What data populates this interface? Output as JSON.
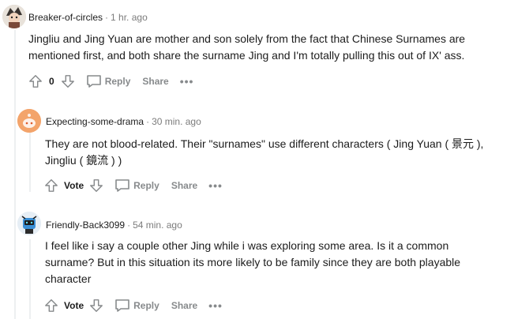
{
  "comments": [
    {
      "author": "Breaker-of-circles",
      "time": "1 hr. ago",
      "body": "Jingliu and Jing Yuan are mother and son solely from the fact that Chinese Surnames are mentioned first, and both share the surname Jing and I'm totally pulling this out of IX' ass.",
      "score": "0",
      "reply_label": "Reply",
      "share_label": "Share",
      "more_label": "•••",
      "avatar_color": "#8a7d72"
    },
    {
      "author": "Expecting-some-drama",
      "time": "30 min. ago",
      "body": "They are not blood-related. Their \"surnames\" use different characters ( Jing Yuan ( 景元 ), Jingliu ( 鏡流 ) )",
      "vote_label": "Vote",
      "reply_label": "Reply",
      "share_label": "Share",
      "more_label": "•••",
      "avatar_color": "#f3a46b"
    },
    {
      "author": "Friendly-Back3099",
      "time": "54 min. ago",
      "body": "I feel like i say a couple other Jing while i was exploring some area. Is it a common surname? But in this situation its more likely to be family since they are both playable character",
      "vote_label": "Vote",
      "reply_label": "Reply",
      "share_label": "Share",
      "more_label": "•••",
      "avatar_color": "#3a8fd6"
    }
  ],
  "separator": "·",
  "colors": {
    "meta": "#7c7c7c",
    "action": "#878a8c",
    "thread": "#edeff1"
  }
}
